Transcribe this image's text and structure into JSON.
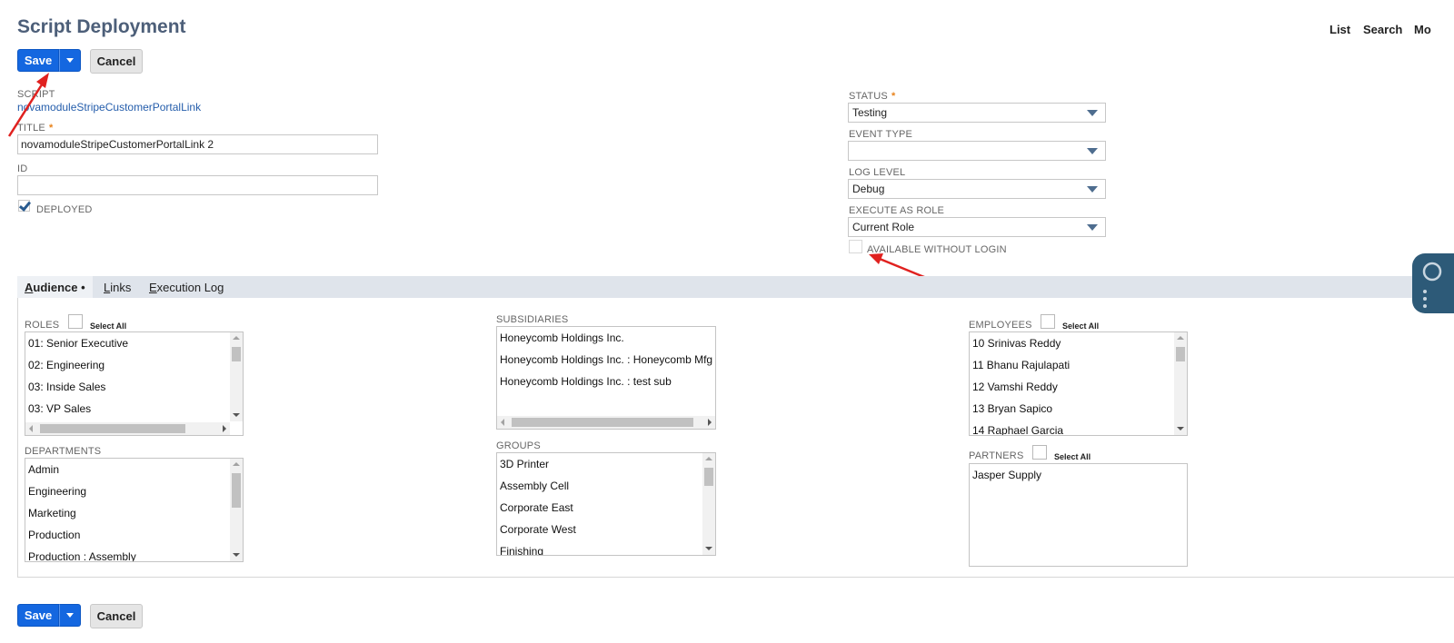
{
  "page": {
    "title": "Script Deployment"
  },
  "top_nav": {
    "list": "List",
    "search": "Search",
    "more": "Mo"
  },
  "buttons": {
    "save": "Save",
    "cancel": "Cancel"
  },
  "form": {
    "script_label": "SCRIPT",
    "script_value": "novamoduleStripeCustomerPortalLink",
    "title_label": "TITLE",
    "required_mark": "*",
    "title_value": "novamoduleStripeCustomerPortalLink 2",
    "id_label": "ID",
    "id_value": "",
    "deployed_label": "DEPLOYED",
    "deployed_checked": true,
    "status_label": "STATUS",
    "status_value": "Testing",
    "event_type_label": "EVENT TYPE",
    "event_type_value": "",
    "log_level_label": "LOG LEVEL",
    "log_level_value": "Debug",
    "execute_as_role_label": "EXECUTE AS ROLE",
    "execute_as_role_value": "Current Role",
    "available_without_login_label": "AVAILABLE WITHOUT LOGIN",
    "available_without_login_checked": false
  },
  "tabs": [
    {
      "label": "Audience",
      "underline": "A",
      "rest": "udience",
      "marker": "•",
      "active": true
    },
    {
      "label": "Links",
      "underline": "L",
      "rest": "inks",
      "active": false
    },
    {
      "label": "Execution Log",
      "underline": "E",
      "rest": "xecution Log",
      "active": false
    }
  ],
  "audience": {
    "select_all": "Select All",
    "roles": {
      "label": "ROLES",
      "items": [
        "01: Senior Executive",
        "02: Engineering",
        "03: Inside Sales",
        "03: VP Sales"
      ]
    },
    "departments": {
      "label": "DEPARTMENTS",
      "items": [
        "Admin",
        "Engineering",
        "Marketing",
        "Production",
        "Production : Assembly"
      ]
    },
    "subsidiaries": {
      "label": "SUBSIDIARIES",
      "items": [
        "Honeycomb Holdings Inc.",
        "Honeycomb Holdings Inc. : Honeycomb Mfg",
        "Honeycomb Holdings Inc. : test sub"
      ]
    },
    "groups": {
      "label": "GROUPS",
      "items": [
        "3D Printer",
        "Assembly Cell",
        "Corporate East",
        "Corporate West",
        "Finishing"
      ]
    },
    "employees": {
      "label": "EMPLOYEES",
      "items": [
        "10 Srinivas Reddy",
        "11 Bhanu Rajulapati",
        "12 Vamshi Reddy",
        "13 Bryan Sapico",
        "14 Raphael Garcia"
      ]
    },
    "partners": {
      "label": "PARTNERS",
      "items": [
        "Jasper Supply"
      ]
    }
  },
  "colors": {
    "primary_button": "#1467e0",
    "title": "#4d5f79",
    "link": "#245dab",
    "required": "#e8821b",
    "tab_bar": "#dfe4eb",
    "annotation_arrow": "#e0211f"
  }
}
